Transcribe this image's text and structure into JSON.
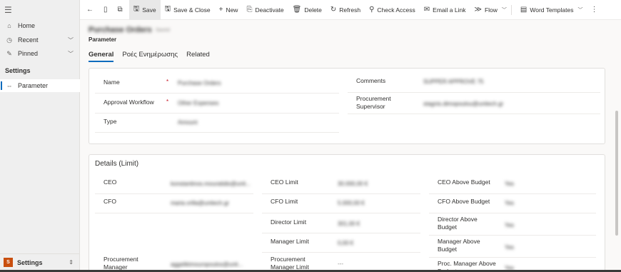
{
  "sidebar": {
    "items": [
      {
        "label": "Home",
        "icon": "home-icon"
      },
      {
        "label": "Recent",
        "icon": "clock-icon"
      },
      {
        "label": "Pinned",
        "icon": "pin-icon"
      }
    ],
    "section_label": "Settings",
    "active_item": {
      "label": "Parameter",
      "icon": "parameter-icon"
    },
    "area": {
      "badge": "S",
      "label": "Settings",
      "badge_color": "#c94f0f"
    }
  },
  "commands": {
    "save": "Save",
    "save_close": "Save & Close",
    "new": "New",
    "deactivate": "Deactivate",
    "delete": "Delete",
    "refresh": "Refresh",
    "check_access": "Check Access",
    "email_link": "Email a Link",
    "flow": "Flow",
    "word_templates": "Word Templates"
  },
  "header": {
    "record_title": "Purchase Orders",
    "record_status": "Saved",
    "entity": "Parameter"
  },
  "tabs": [
    "General",
    "Ροές Ενημέρωσης",
    "Related"
  ],
  "general": {
    "name_label": "Name",
    "name_value": "Purchase Orders",
    "workflow_label": "Approval Workflow",
    "workflow_value": "Other Expenses",
    "type_label": "Type",
    "type_value": "Amount",
    "comments_label": "Comments",
    "comments_value": "SUPPER APPROVE 75",
    "supervisor_label": "Procurement Supervisor",
    "supervisor_value": "stagnis.dimopoulou@unitech.gr",
    "required_mark": "*"
  },
  "details": {
    "title": "Details (Limit)",
    "ceo_label": "CEO",
    "ceo_value": "konstantinos.mouratidis@unit...",
    "cfo_label": "CFO",
    "cfo_value": "maria.vrilla@unitech.gr",
    "proc_manager_label": "Procurement Manager",
    "proc_manager_value": "aggelikimouropoulos@unit...",
    "ceo_limit_label": "CEO Limit",
    "ceo_limit_value": "30.000,00 €",
    "cfo_limit_label": "CFO Limit",
    "cfo_limit_value": "5.000,00 €",
    "director_limit_label": "Director Limit",
    "director_limit_value": "301,00 €",
    "manager_limit_label": "Manager Limit",
    "manager_limit_value": "0,00 €",
    "proc_manager_limit_label": "Procurement Manager Limit",
    "proc_manager_limit_value": "---",
    "ceo_above_label": "CEO Above Budget",
    "ceo_above_value": "Yes",
    "cfo_above_label": "CFO Above Budget",
    "cfo_above_value": "Yes",
    "director_above_label": "Director Above Budget",
    "director_above_value": "Yes",
    "manager_above_label": "Manager Above Budget",
    "manager_above_value": "Yes",
    "proc_manager_above_label": "Proc. Manager Above Budget",
    "proc_manager_above_value": "Yes"
  }
}
